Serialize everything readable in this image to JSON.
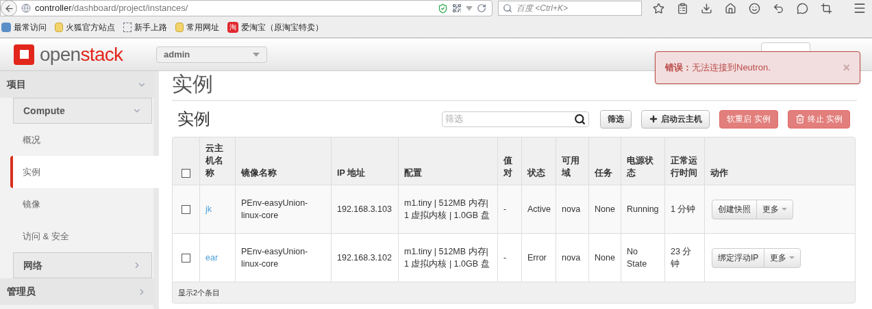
{
  "browser": {
    "url_host": "controller",
    "url_path": "/dashboard/project/instances/",
    "search_placeholder": "百度 <Ctrl+K>",
    "bookmarks": [
      {
        "kind": "search",
        "label": "最常访问"
      },
      {
        "kind": "folder",
        "label": "火狐官方站点"
      },
      {
        "kind": "dashed",
        "label": "新手上路"
      },
      {
        "kind": "folder",
        "label": "常用网址"
      },
      {
        "kind": "badge",
        "icon_text": "淘",
        "label": "爱淘宝（原淘宝特卖）"
      }
    ]
  },
  "header": {
    "logo_left": "open",
    "logo_right": "stack",
    "project": "admin"
  },
  "alert": {
    "title": "错误：",
    "message": "无法连接到Neutron.",
    "close": "×"
  },
  "sidebar": [
    {
      "label": "项目",
      "expanded": true,
      "children": [
        {
          "label": "Compute",
          "expanded": true,
          "children": [
            {
              "label": "概况",
              "selected": false
            },
            {
              "label": "实例",
              "selected": true
            },
            {
              "label": "镜像",
              "selected": false
            },
            {
              "label": "访问 & 安全",
              "selected": false
            }
          ]
        },
        {
          "label": "网络",
          "expanded": false
        }
      ]
    },
    {
      "label": "管理员",
      "expanded": false
    }
  ],
  "page_title": "实例",
  "table_title": "实例",
  "filter": {
    "placeholder": "筛选"
  },
  "actions": [
    {
      "kind": "plain",
      "label": "筛选",
      "disabled": false
    },
    {
      "kind": "plus",
      "label": "启动云主机",
      "disabled": false
    },
    {
      "kind": "danger",
      "label": "软重启 实例",
      "disabled": true
    },
    {
      "kind": "trash",
      "label": "终止 实例",
      "disabled": true
    }
  ],
  "table": {
    "select_all": {
      "checked": false
    },
    "columns": [
      "云主机名称",
      "镜像名称",
      "IP 地址",
      "配置",
      "值对",
      "状态",
      "可用域",
      "任务",
      "电源状态",
      "正常运行时间",
      "动作"
    ],
    "rows": [
      {
        "checked": false,
        "name": "jk",
        "image": "PEnv-easyUnion-linux-core",
        "ip": "192.168.3.103",
        "config": "m1.tiny | 512MB 内存| 1 虚拟内核 | 1.0GB 盘",
        "keypair": "-",
        "status": "Active",
        "zone": "nova",
        "task": "None",
        "power": "Running",
        "uptime": "1 分钟",
        "action": "创建快照",
        "more": "更多"
      },
      {
        "checked": false,
        "name": "ear",
        "image": "PEnv-easyUnion-linux-core",
        "ip": "192.168.3.102",
        "config": "m1.tiny | 512MB 内存| 1 虚拟内核 | 1.0GB 盘",
        "keypair": "-",
        "status": "Error",
        "zone": "nova",
        "task": "None",
        "power": "No State",
        "uptime": "23 分钟",
        "action": "绑定浮动IP",
        "more": "更多"
      }
    ],
    "footer": "显示2个条目"
  }
}
